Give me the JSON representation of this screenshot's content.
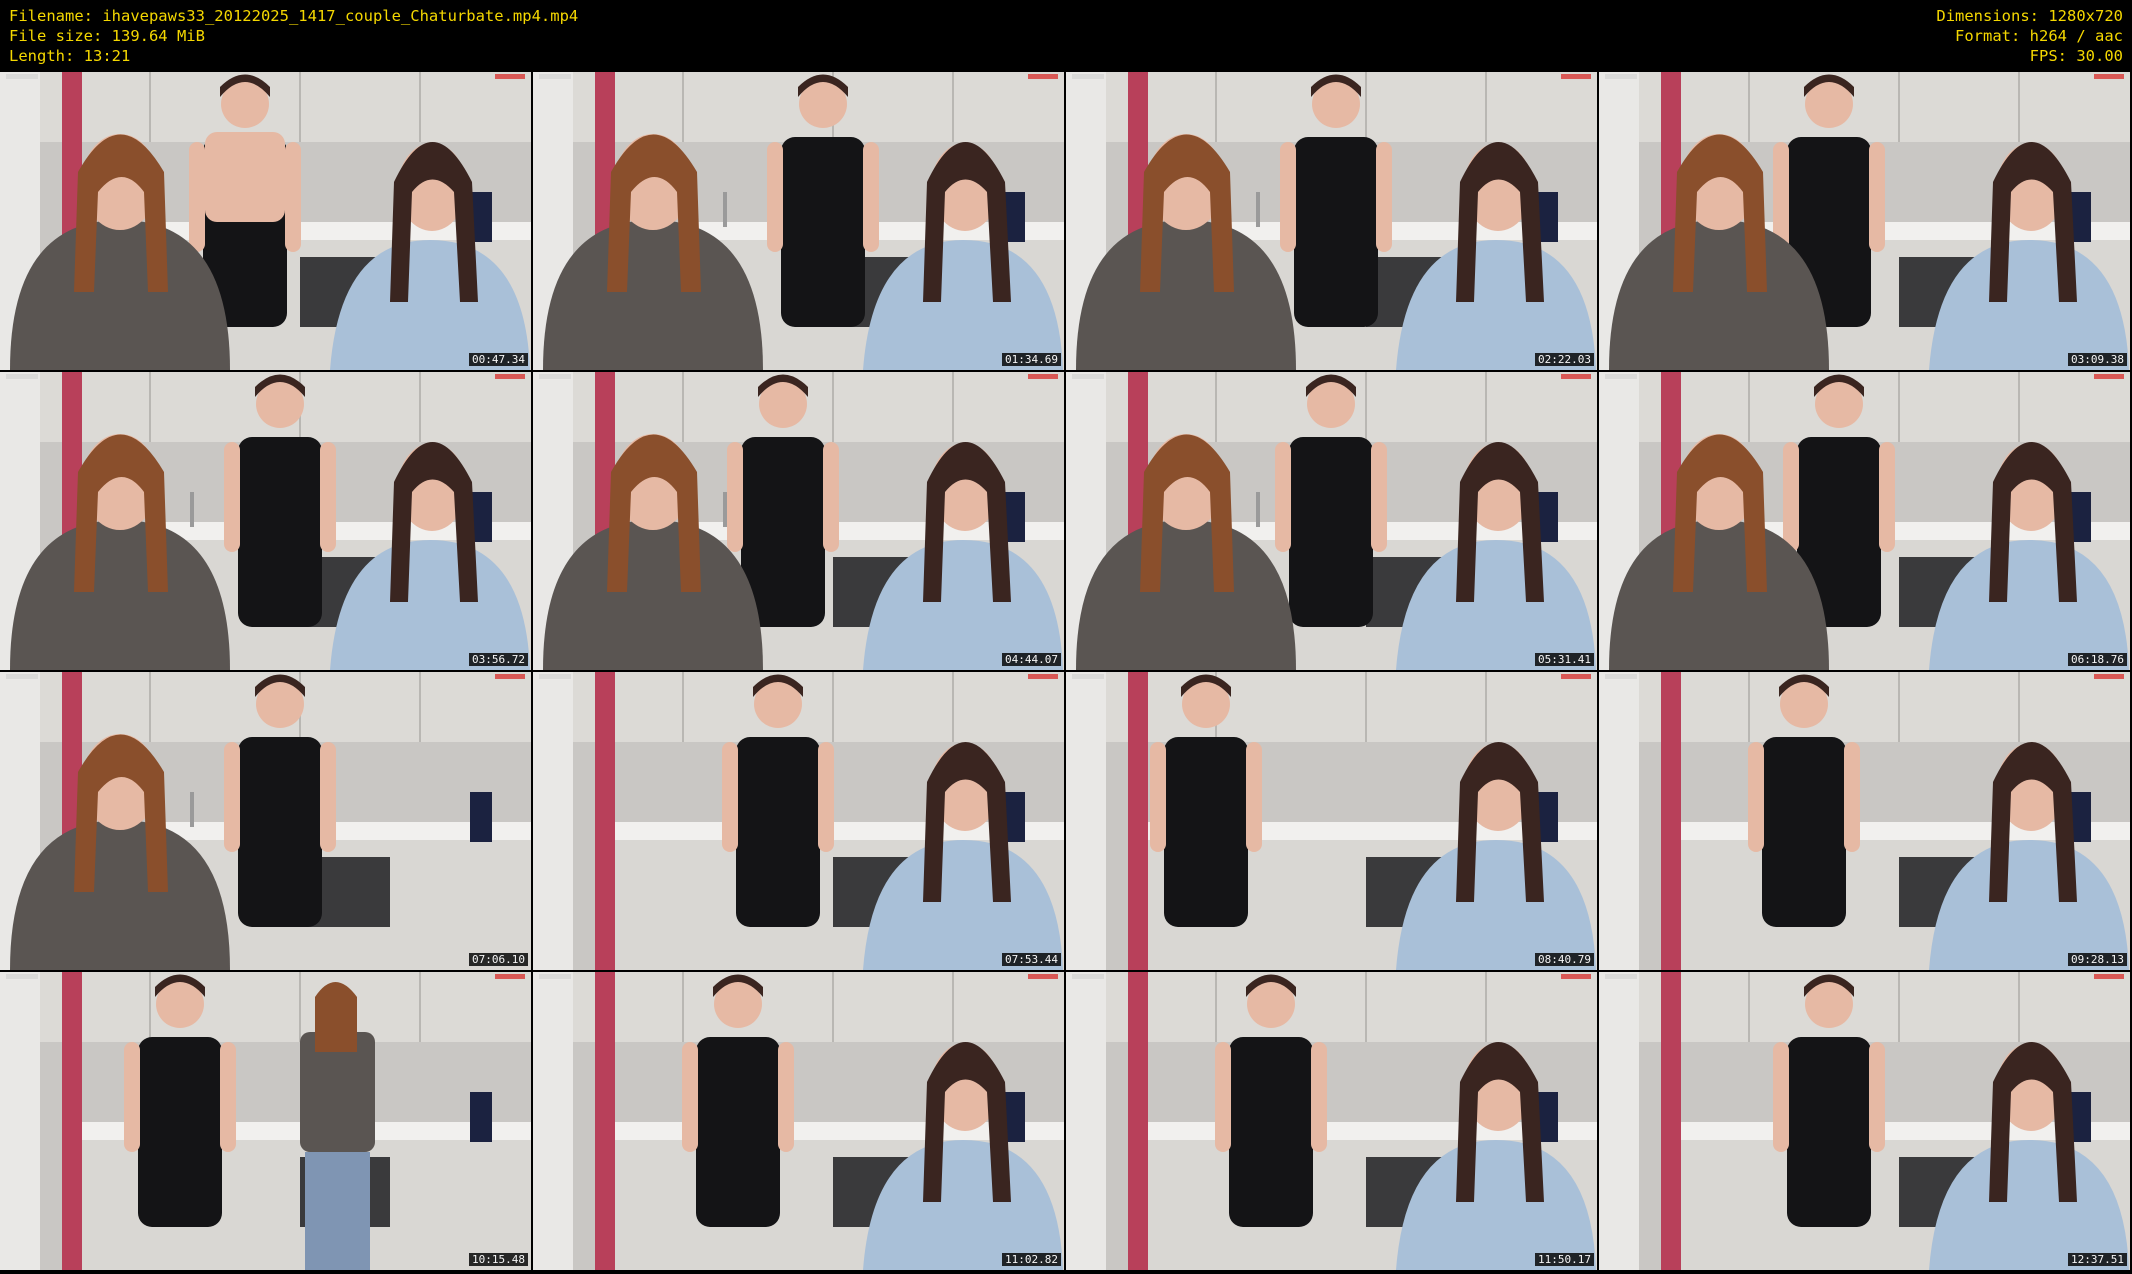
{
  "header": {
    "filename_line": "Filename: ihavepaws33_20122025_1417_couple_Chaturbate.mp4.mp4",
    "filesize_line": "File size: 139.64 MiB",
    "length_line": "Length: 13:21",
    "dimensions_line": "Dimensions: 1280x720",
    "format_line": "Format: h264 / aac",
    "fps_line": "FPS: 30.00"
  },
  "colors": {
    "meta_text": "#f5d800",
    "background": "#000000",
    "cabinet": "#dcdad6",
    "wall": "#c9c7c4",
    "red_door": "#b8405a",
    "shirt_gray": "#5a5552",
    "shirt_blue": "#a9c0d8",
    "dress_black": "#141416",
    "skin": "#e6b9a4",
    "hair_auburn": "#8a4f2c",
    "hair_dark": "#3a2520"
  },
  "thumbnails": [
    {
      "timestamp": "00:47.34"
    },
    {
      "timestamp": "01:34.69"
    },
    {
      "timestamp": "02:22.03"
    },
    {
      "timestamp": "03:09.38"
    },
    {
      "timestamp": "03:56.72"
    },
    {
      "timestamp": "04:44.07"
    },
    {
      "timestamp": "05:31.41"
    },
    {
      "timestamp": "06:18.76"
    },
    {
      "timestamp": "07:06.10"
    },
    {
      "timestamp": "07:53.44"
    },
    {
      "timestamp": "08:40.79"
    },
    {
      "timestamp": "09:28.13"
    },
    {
      "timestamp": "10:15.48"
    },
    {
      "timestamp": "11:02.82"
    },
    {
      "timestamp": "11:50.17"
    },
    {
      "timestamp": "12:37.51"
    }
  ]
}
